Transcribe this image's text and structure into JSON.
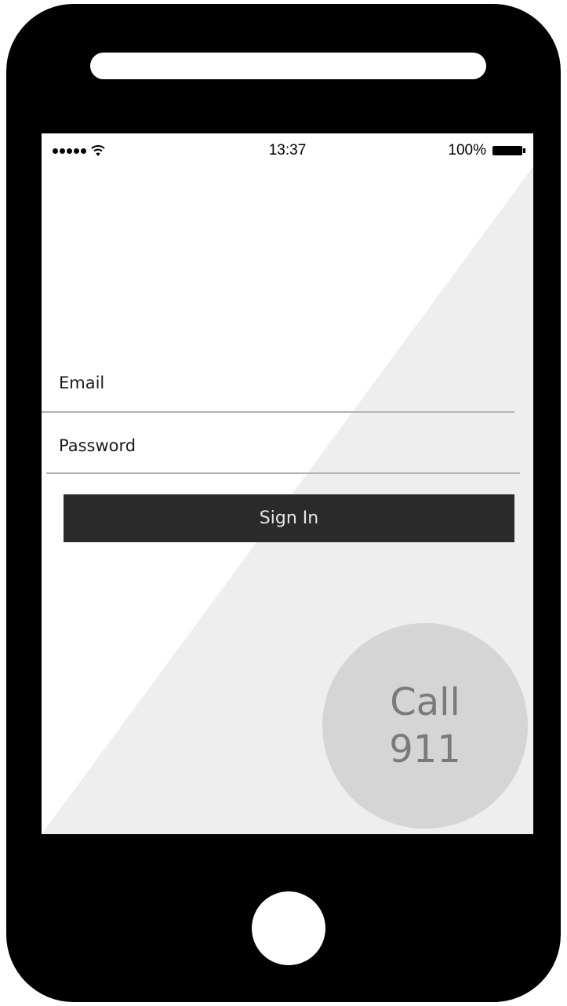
{
  "status_bar": {
    "time": "13:37",
    "battery": "100%",
    "signal_icon": "signal-dots-icon",
    "wifi_icon": "wifi-icon",
    "battery_icon": "battery-icon"
  },
  "login": {
    "email_label": "Email",
    "password_label": "Password",
    "signin_label": "Sign In"
  },
  "emergency": {
    "line1": "Call",
    "line2": "911"
  },
  "colors": {
    "device": "#000000",
    "screen_bg": "#ffffff",
    "diagonal_shade": "#eeeeee",
    "button_dark": "#2a2a2a",
    "call_circle": "#d5d5d5",
    "call_text": "#7a7a7a"
  }
}
